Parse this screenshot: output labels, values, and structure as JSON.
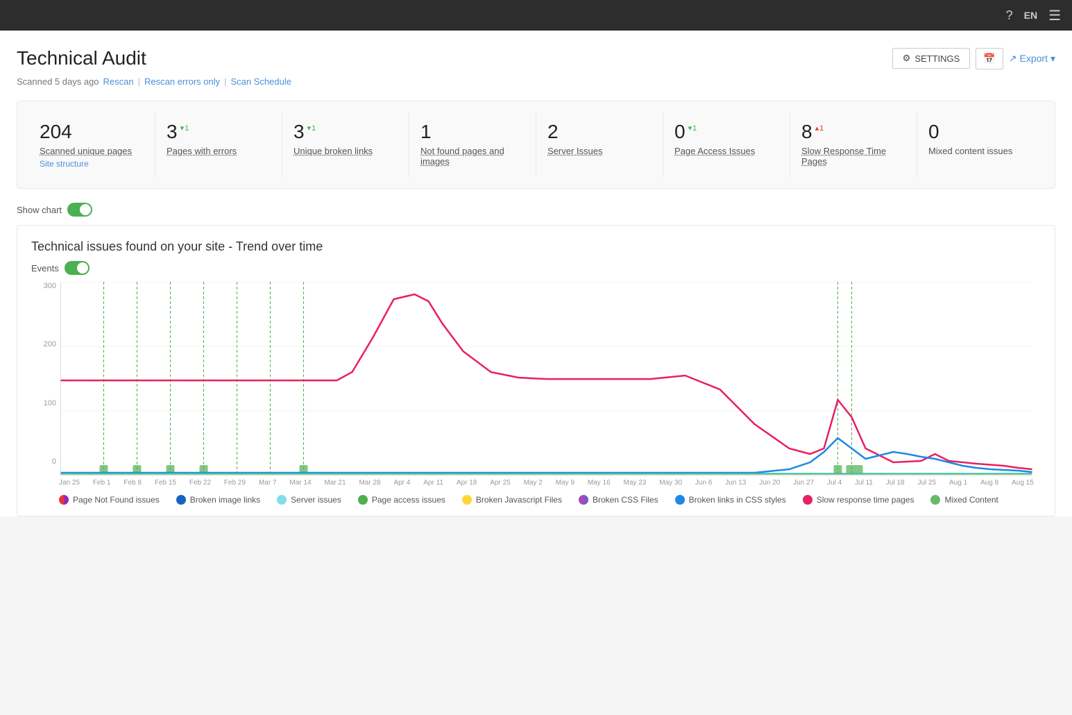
{
  "topbar": {
    "help_icon": "?",
    "language": "EN",
    "menu_icon": "☰"
  },
  "header": {
    "title": "Technical Audit",
    "settings_label": "SETTINGS",
    "export_label": "Export"
  },
  "scan_info": {
    "scanned_text": "Scanned 5 days ago",
    "rescan_label": "Rescan",
    "rescan_errors_label": "Rescan errors only",
    "scan_schedule_label": "Scan Schedule"
  },
  "stats": [
    {
      "number": "204",
      "label": "Scanned unique pages",
      "sublabel": "Site structure",
      "badge": null
    },
    {
      "number": "3",
      "label": "Pages with errors",
      "badge": {
        "direction": "down",
        "value": "1"
      }
    },
    {
      "number": "3",
      "label": "Unique broken links",
      "badge": {
        "direction": "down",
        "value": "1"
      }
    },
    {
      "number": "1",
      "label": "Not found pages and images",
      "badge": null
    },
    {
      "number": "2",
      "label": "Server Issues",
      "badge": null
    },
    {
      "number": "0",
      "label": "Page Access Issues",
      "badge": {
        "direction": "down",
        "value": "1"
      }
    },
    {
      "number": "8",
      "label": "Slow Response Time Pages",
      "badge": {
        "direction": "up",
        "value": "1"
      }
    },
    {
      "number": "0",
      "label": "Mixed content issues",
      "badge": null
    }
  ],
  "chart": {
    "show_chart_label": "Show chart",
    "title": "Technical issues found on your site - Trend over time",
    "events_label": "Events",
    "x_labels": [
      "Jan 25",
      "Feb 1",
      "Feb 8",
      "Feb 15",
      "Feb 22",
      "Feb 29",
      "Mar 7",
      "Mar 14",
      "Mar 21",
      "Mar 28",
      "Apr 4",
      "Apr 11",
      "Apr 18",
      "Apr 25",
      "May 2",
      "May 9",
      "May 16",
      "May 23",
      "May 30",
      "Jun 6",
      "Jun 13",
      "Jun 20",
      "Jun 27",
      "Jul 4",
      "Jul 11",
      "Jul 18",
      "Jul 25",
      "Aug 1",
      "Aug 8",
      "Aug 15"
    ],
    "y_labels": [
      "300",
      "200",
      "100",
      "0"
    ],
    "legend": [
      {
        "label": "Page Not Found issues",
        "color": "#e53935",
        "type": "half"
      },
      {
        "label": "Broken image links",
        "color": "#1565c0",
        "type": "full"
      },
      {
        "label": "Server issues",
        "color": "#80deea",
        "type": "full"
      },
      {
        "label": "Page access issues",
        "color": "#4caf50",
        "type": "full"
      },
      {
        "label": "Broken Javascript Files",
        "color": "#fdd835",
        "type": "full"
      },
      {
        "label": "Broken CSS Files",
        "color": "#ab47bc",
        "type": "half"
      },
      {
        "label": "Broken links in CSS styles",
        "color": "#1e88e5",
        "type": "full"
      },
      {
        "label": "Slow response time pages",
        "color": "#e91e63",
        "type": "full"
      },
      {
        "label": "Mixed Content",
        "color": "#66bb6a",
        "type": "full"
      }
    ]
  }
}
